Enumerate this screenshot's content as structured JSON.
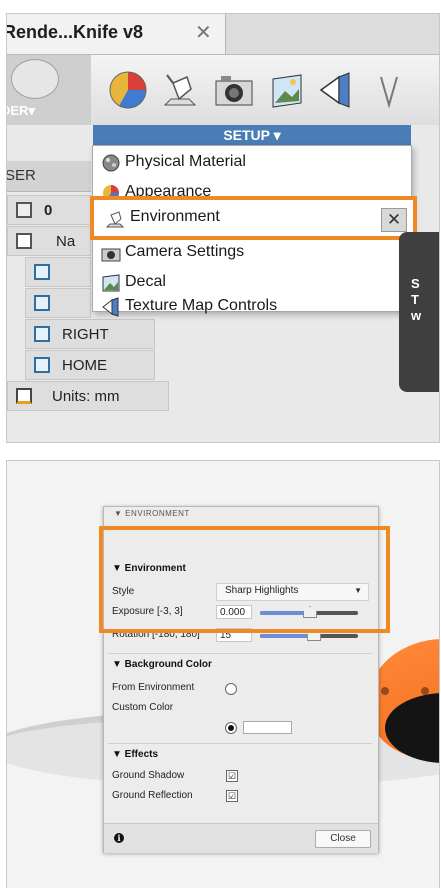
{
  "top": {
    "tab_title": "Rende...Knife v8",
    "tab_close": "✕",
    "ribbon_left_label": "DER▾",
    "browser_header": "SER",
    "setup_label": "SETUP ▾",
    "menu": [
      {
        "label": "Physical Material",
        "icon": "sphere-icon"
      },
      {
        "label": "Appearance",
        "icon": "appearance-icon"
      },
      {
        "label": "Environment",
        "icon": "environment-lamp-icon"
      },
      {
        "label": "Camera Settings",
        "icon": "camera-icon"
      },
      {
        "label": "Decal",
        "icon": "decal-icon"
      },
      {
        "label": "Texture Map Controls",
        "icon": "texture-map-icon"
      }
    ],
    "environment_close": "✕",
    "tree": {
      "row1_value": "0",
      "row2_label": "Na",
      "right": "RIGHT",
      "home": "HOME",
      "units": "Units: mm"
    },
    "tooltip_lines": [
      "S",
      "T",
      "w"
    ]
  },
  "dialog": {
    "title": "▼ ENVIRONMENT",
    "environment_header": "▼  Environment",
    "style_label": "Style",
    "style_value": "Sharp Highlights",
    "exposure_label": "Exposure [-3, 3]",
    "exposure_value": "0.000",
    "exposure_level": 0.5,
    "rotation_label": "Rotation [-180, 180]",
    "rotation_value": "15",
    "rotation_level": 0.542,
    "background_header": "▼  Background Color",
    "from_env_label": "From Environment",
    "custom_color_label": "Custom Color",
    "effects_header": "▼  Effects",
    "ground_shadow_label": "Ground Shadow",
    "ground_reflection_label": "Ground Reflection",
    "close_label": "Close",
    "info_glyph": "i",
    "check_glyph": "☑",
    "custom_color": "#ffffff"
  },
  "colors": {
    "highlight": "#ee8a23",
    "setup_bar": "#4a7db5",
    "slider_fill": "#6b8ed6",
    "knife_orange": "#f26a1b"
  }
}
